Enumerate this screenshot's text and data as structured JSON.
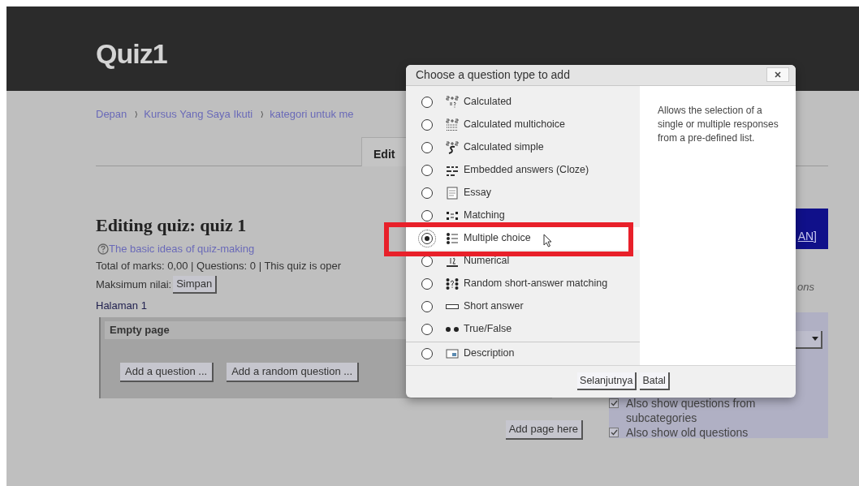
{
  "page": {
    "title": "Quiz1",
    "breadcrumb": [
      "Depan",
      "Kursus Yang Saya Ikuti",
      "kategori untuk me"
    ],
    "tab": "Edit",
    "heading": "Editing quiz: quiz 1",
    "help_link": "The basic ideas of quiz-making",
    "summary": "Total of marks: 0,00 | Questions: 0 | This quiz is oper",
    "max_grade_label": "Maksimum nilai:",
    "save_button": "Simpan",
    "page_label": "Halaman 1",
    "empty_page": {
      "title": "Empty page",
      "buttons": [
        "Add a question ...",
        "Add a random question ..."
      ]
    },
    "add_page_button": "Add page here",
    "side_panel": {
      "banner": "AN]",
      "note": "ons",
      "options": [
        {
          "label": "Also show questions from subcategories",
          "checked": true
        },
        {
          "label": "Also show old questions",
          "checked": true
        }
      ]
    }
  },
  "dialog": {
    "title": "Choose a question type to add",
    "question_types": [
      {
        "kind": "calculated",
        "label": "Calculated",
        "selected": false
      },
      {
        "kind": "calculated-multichoice",
        "label": "Calculated multichoice",
        "selected": false
      },
      {
        "kind": "calculated-simple",
        "label": "Calculated simple",
        "selected": false
      },
      {
        "kind": "embedded",
        "label": "Embedded answers (Cloze)",
        "selected": false
      },
      {
        "kind": "essay",
        "label": "Essay",
        "selected": false
      },
      {
        "kind": "matching",
        "label": "Matching",
        "selected": false
      },
      {
        "kind": "multichoice",
        "label": "Multiple choice",
        "selected": true
      },
      {
        "kind": "numerical",
        "label": "Numerical",
        "selected": false
      },
      {
        "kind": "random-matching",
        "label": "Random short-answer matching",
        "selected": false
      },
      {
        "kind": "short-answer",
        "label": "Short answer",
        "selected": false
      },
      {
        "kind": "truefalse",
        "label": "True/False",
        "selected": false
      }
    ],
    "other_types": [
      {
        "kind": "description",
        "label": "Description",
        "selected": false
      }
    ],
    "description": "Allows the selection of a single or multiple responses from a pre-defined list.",
    "buttons": [
      "Selanjutnya",
      "Batal"
    ]
  }
}
